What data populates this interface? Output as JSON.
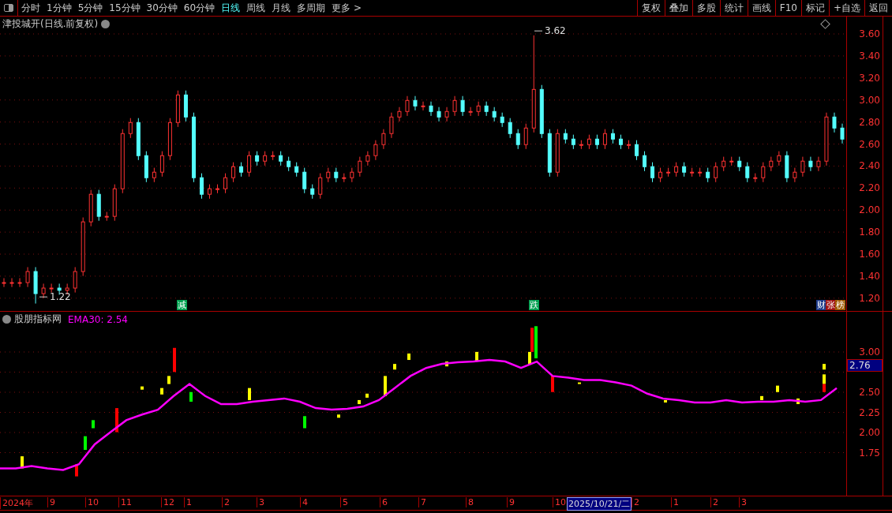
{
  "toolbar": {
    "periods": [
      {
        "label": "分时",
        "selected": false
      },
      {
        "label": "1分钟",
        "selected": false
      },
      {
        "label": "5分钟",
        "selected": false
      },
      {
        "label": "15分钟",
        "selected": false
      },
      {
        "label": "30分钟",
        "selected": false
      },
      {
        "label": "60分钟",
        "selected": false
      },
      {
        "label": "日线",
        "selected": true
      },
      {
        "label": "周线",
        "selected": false
      },
      {
        "label": "月线",
        "selected": false
      },
      {
        "label": "多周期",
        "selected": false
      },
      {
        "label": "更多 >",
        "selected": false
      }
    ],
    "actions": [
      "复权",
      "叠加",
      "多股",
      "统计",
      "画线",
      "F10",
      "标记",
      "+自选",
      "返回"
    ]
  },
  "main_chart": {
    "title": "津投城开(日线.前复权)",
    "high_label": "3.62",
    "low_label": "1.22",
    "price_axis": [
      "3.60",
      "3.40",
      "3.20",
      "3.00",
      "2.80",
      "2.60",
      "2.40",
      "2.20",
      "2.00",
      "1.80",
      "1.60",
      "1.40",
      "1.20"
    ],
    "events": [
      {
        "text": "减",
        "color": "#00a050"
      },
      {
        "text": "跌",
        "color": "#00a050"
      },
      {
        "text": "财",
        "color": "#1e3c8c"
      },
      {
        "text": "张",
        "color": "#a01010"
      },
      {
        "text": "榜",
        "color": "#a05a00"
      }
    ]
  },
  "indicator": {
    "name": "股朋指标网",
    "reading": "EMA30: 2.54",
    "current_label": "2.76",
    "value_axis": [
      "3.00",
      "2.50",
      "2.25",
      "2.00",
      "1.75"
    ]
  },
  "time_axis": {
    "labels": [
      "2024年",
      "9",
      "10",
      "11",
      "12",
      "1",
      "2",
      "3",
      "4",
      "5",
      "6",
      "7",
      "8",
      "9",
      "10"
    ],
    "cursor_date": "2025/10/21/二",
    "labels_after": [
      "2",
      "1",
      "2",
      "3"
    ]
  }
}
